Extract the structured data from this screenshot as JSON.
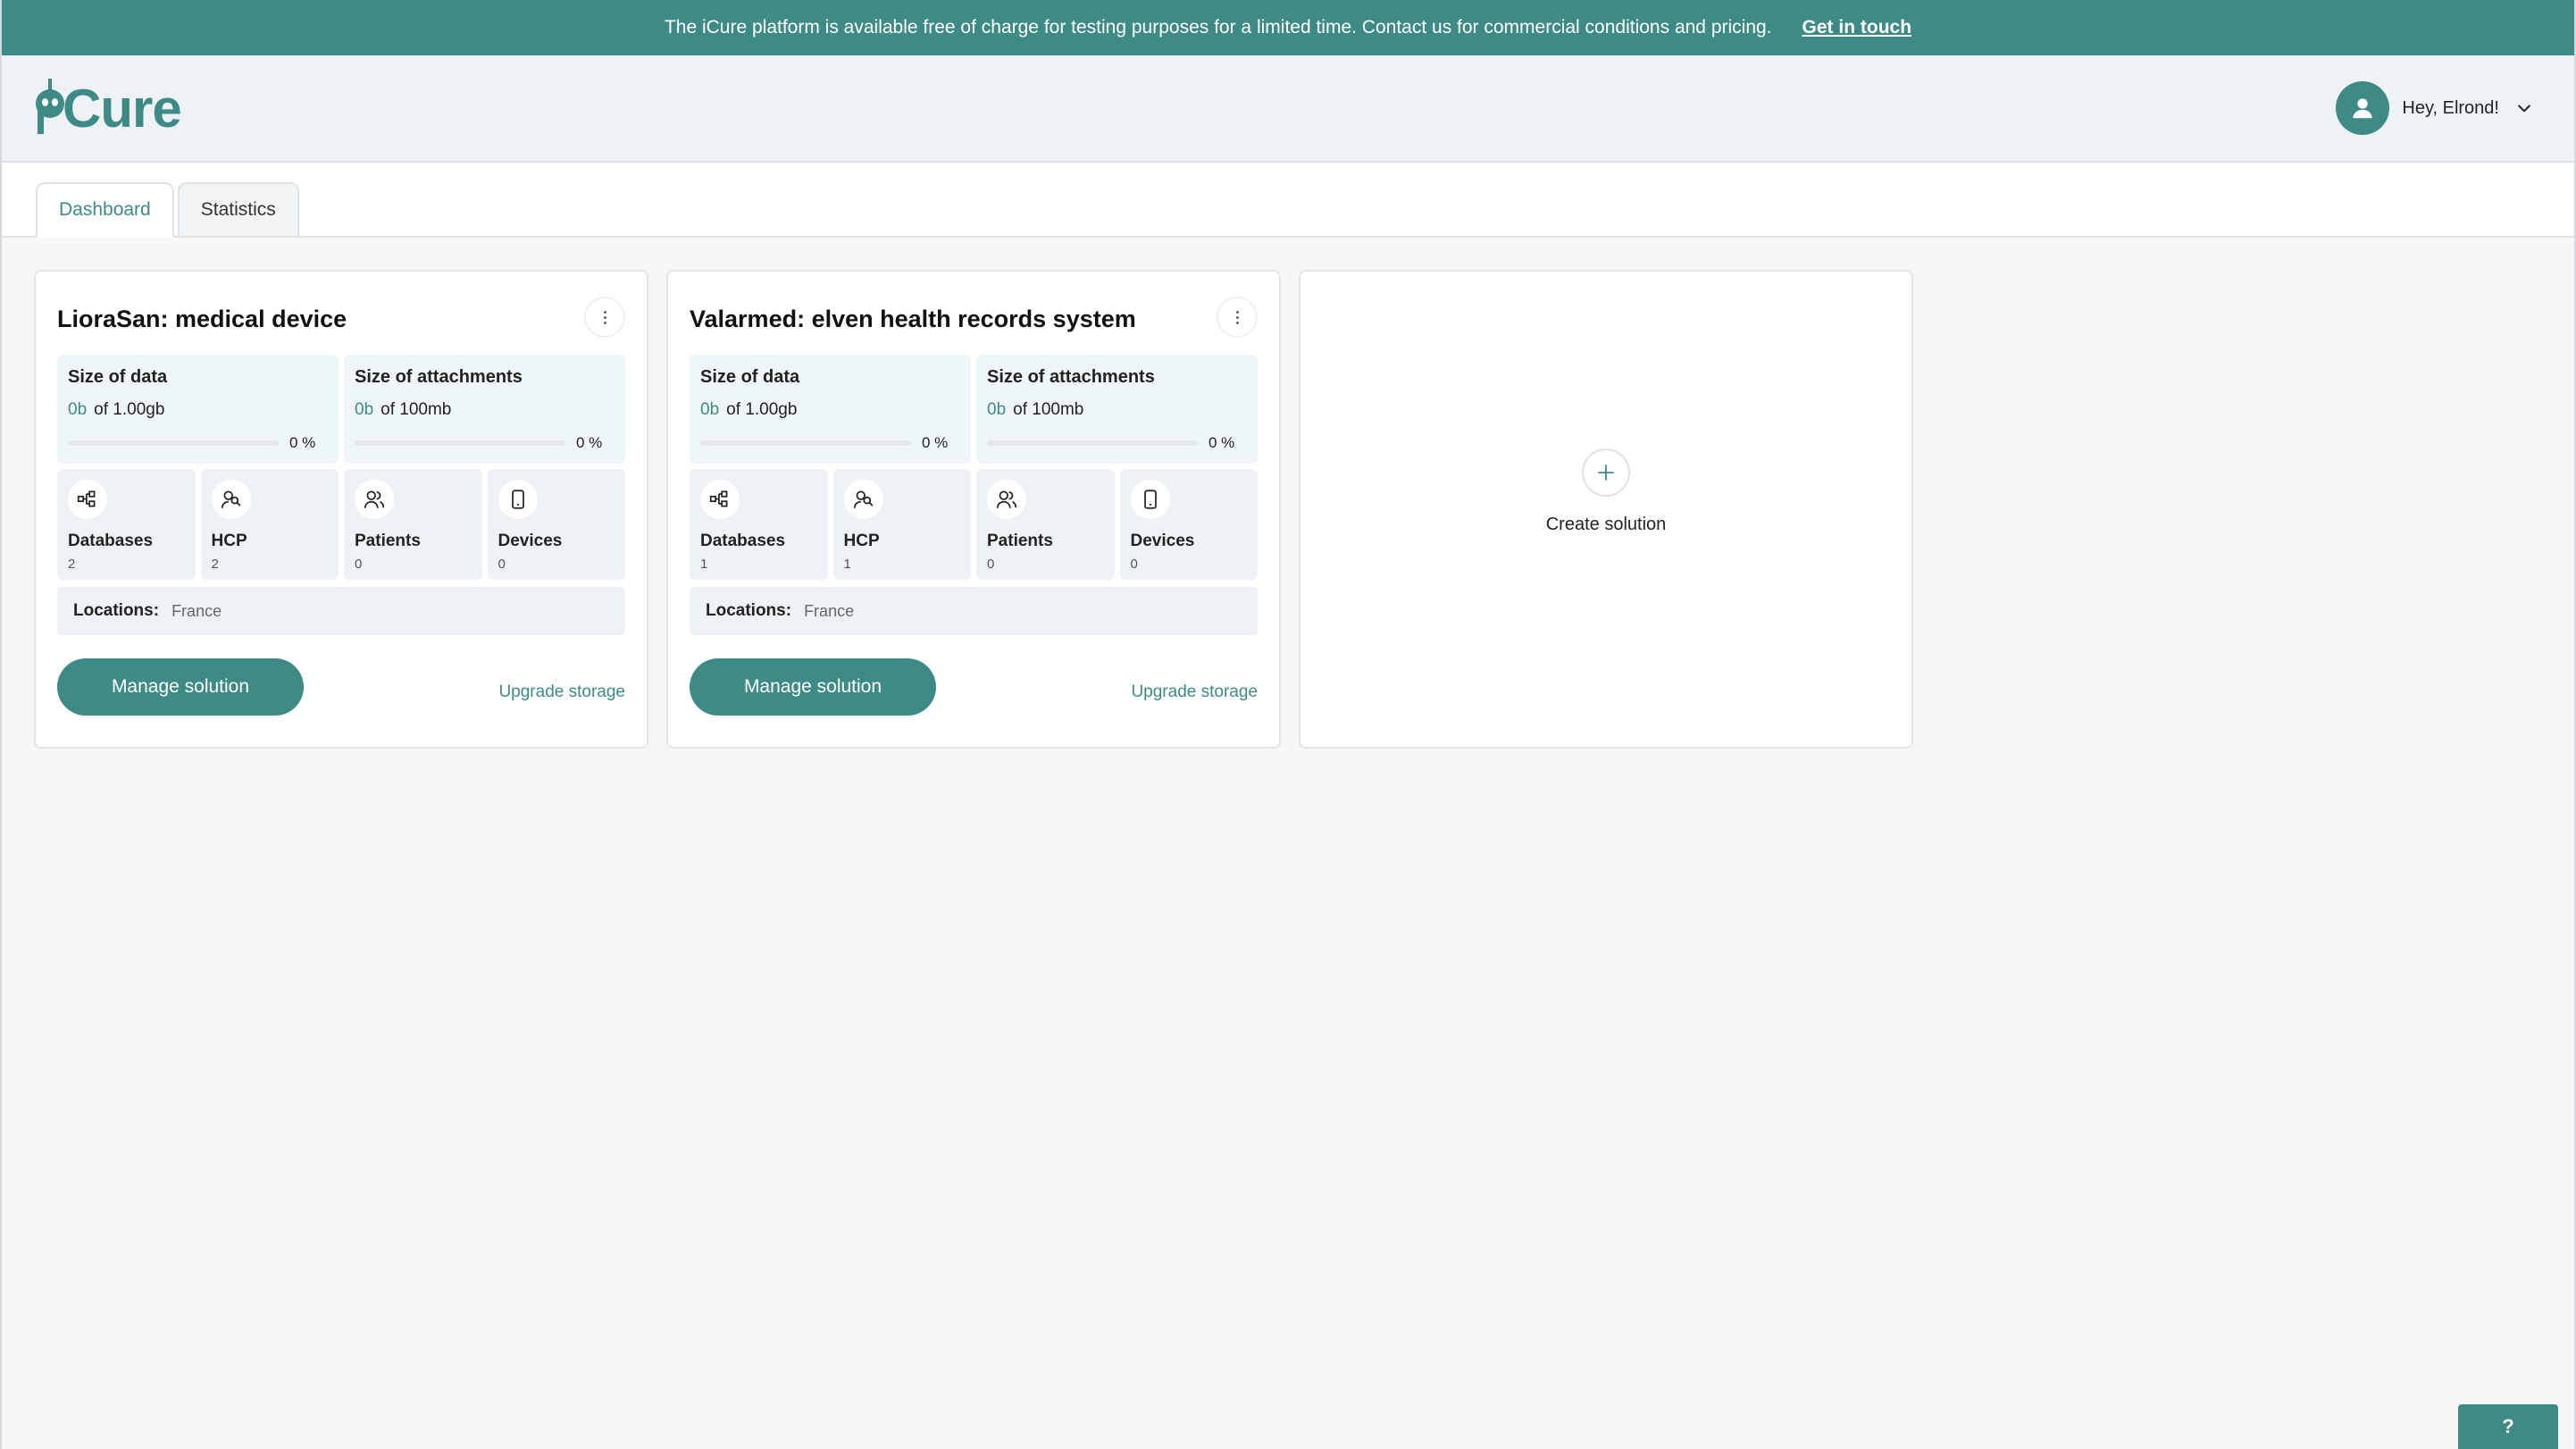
{
  "banner": {
    "message": "The iCure platform is available free of charge for testing purposes for a limited time. Contact us for commercial conditions and pricing.",
    "link": "Get in touch"
  },
  "header": {
    "logo_text": "iCure",
    "greeting": "Hey, Elrond!"
  },
  "tabs": [
    {
      "label": "Dashboard",
      "active": true
    },
    {
      "label": "Statistics",
      "active": false
    }
  ],
  "solutions": [
    {
      "title": "LioraSan: medical device",
      "data": {
        "label": "Size of data",
        "used": "0b",
        "of": "of",
        "total": "1.00gb",
        "percent": "0 %",
        "fraction": 0
      },
      "attachments": {
        "label": "Size of attachments",
        "used": "0b",
        "of": "of",
        "total": "100mb",
        "percent": "0 %",
        "fraction": 0
      },
      "stats": [
        {
          "label": "Databases",
          "count": "2",
          "icon": "databases-icon"
        },
        {
          "label": "HCP",
          "count": "2",
          "icon": "hcp-icon"
        },
        {
          "label": "Patients",
          "count": "0",
          "icon": "patients-icon"
        },
        {
          "label": "Devices",
          "count": "0",
          "icon": "devices-icon"
        }
      ],
      "locations_label": "Locations:",
      "locations": "France",
      "manage": "Manage solution",
      "upgrade": "Upgrade storage"
    },
    {
      "title": "Valarmed: elven health records system",
      "data": {
        "label": "Size of data",
        "used": "0b",
        "of": "of",
        "total": "1.00gb",
        "percent": "0 %",
        "fraction": 0
      },
      "attachments": {
        "label": "Size of attachments",
        "used": "0b",
        "of": "of",
        "total": "100mb",
        "percent": "0 %",
        "fraction": 0
      },
      "stats": [
        {
          "label": "Databases",
          "count": "1",
          "icon": "databases-icon"
        },
        {
          "label": "HCP",
          "count": "1",
          "icon": "hcp-icon"
        },
        {
          "label": "Patients",
          "count": "0",
          "icon": "patients-icon"
        },
        {
          "label": "Devices",
          "count": "0",
          "icon": "devices-icon"
        }
      ],
      "locations_label": "Locations:",
      "locations": "France",
      "manage": "Manage solution",
      "upgrade": "Upgrade storage"
    }
  ],
  "create": {
    "label": "Create solution",
    "icon": "plus-icon"
  },
  "help": {
    "label": "?"
  },
  "colors": {
    "accent": "#3e8a86",
    "banner_bg": "#3e8a86",
    "header_bg": "#eff2f5",
    "storage_bg": "#eef6f8"
  }
}
